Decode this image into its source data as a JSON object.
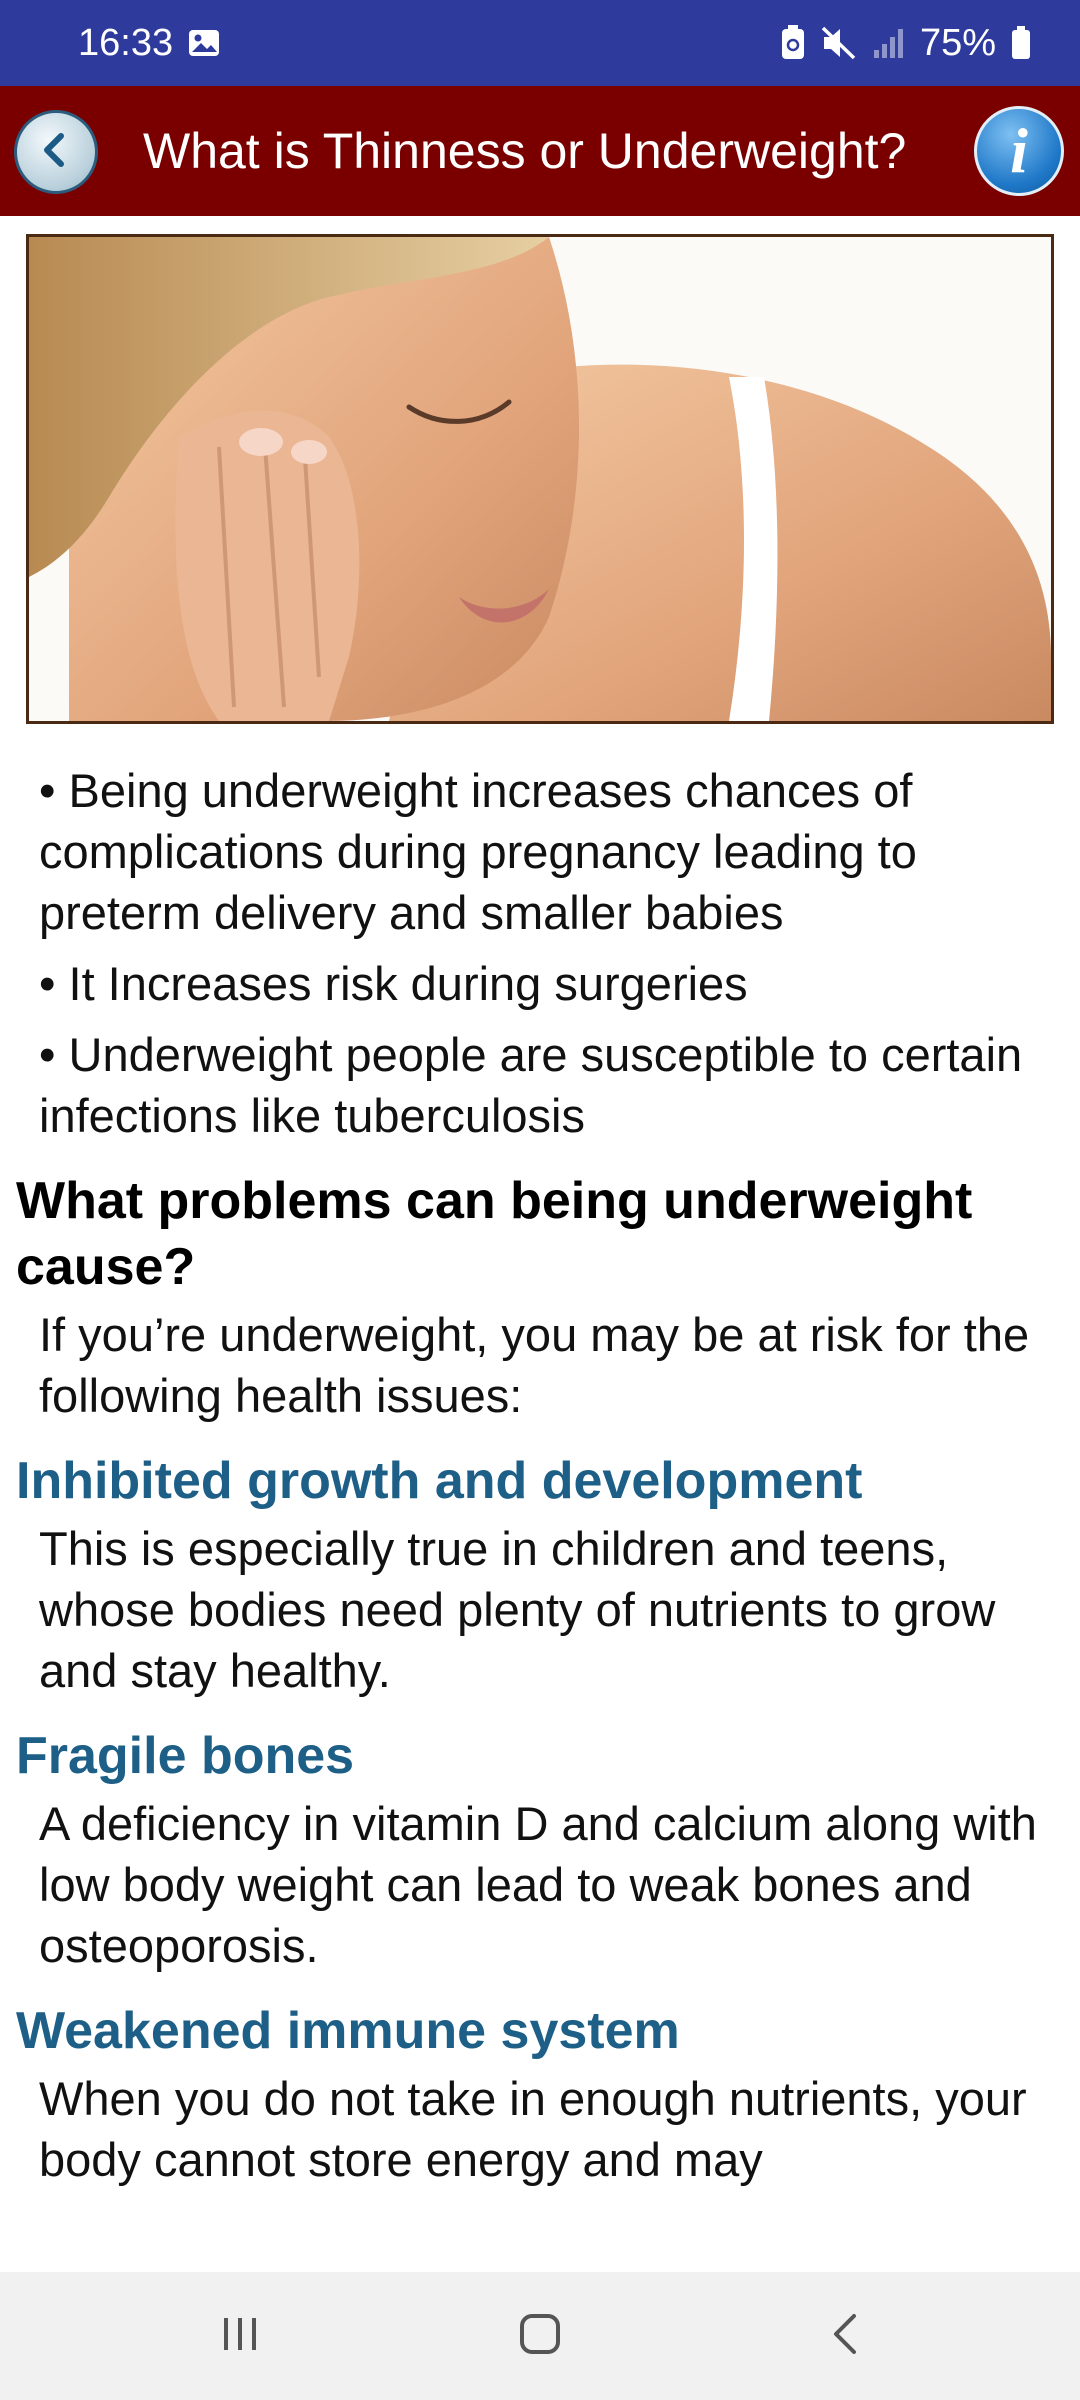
{
  "status_bar": {
    "time": "16:33",
    "battery": "75%"
  },
  "app_bar": {
    "title": "What is Thinness or Underweight?",
    "info_label": "i"
  },
  "bullets": [
    "• Being underweight increases chances of complications during pregnancy leading to preterm delivery and smaller babies",
    "• It Increases risk during surgeries",
    "• Underweight people are susceptible to certain infections like tuberculosis"
  ],
  "section": {
    "heading": "What problems can being underweight cause?",
    "intro": "If you’re underweight, you may be at risk for the following health issues:"
  },
  "issues": [
    {
      "title": "Inhibited growth and development",
      "text": "This is especially true in children and teens, whose bodies need plenty of nutrients to grow and stay healthy."
    },
    {
      "title": "Fragile bones",
      "text": "A deficiency in vitamin D and calcium along with low body weight can lead to weak bones and osteoporosis."
    },
    {
      "title": "Weakened immune system",
      "text": "When you do not take in enough nutrients, your body cannot store energy and may"
    }
  ],
  "colors": {
    "status_bar": "#2e3a9c",
    "app_bar": "#7a0000",
    "subheading": "#1d5f86"
  },
  "icons": {
    "status_left": [
      "image-icon"
    ],
    "status_right": [
      "battery-saver-icon",
      "mute-icon",
      "signal-icon",
      "battery-icon"
    ],
    "app_bar": [
      "back-arrow-icon",
      "info-icon"
    ],
    "nav": [
      "recent-apps-icon",
      "home-icon",
      "back-icon"
    ]
  }
}
